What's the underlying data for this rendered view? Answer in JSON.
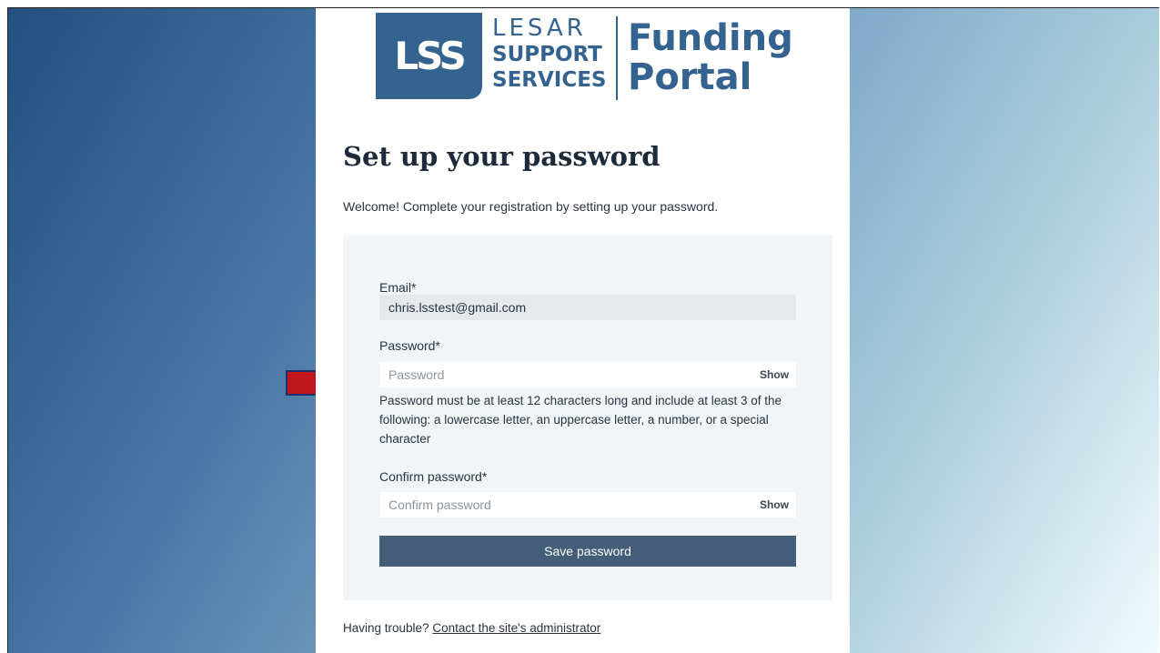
{
  "logo": {
    "mark": "LSS",
    "line1": "LESAR",
    "line2": "SUPPORT",
    "line3": "SERVICES",
    "product_line1": "Funding",
    "product_line2": "Portal",
    "brand_color": "#346390"
  },
  "page": {
    "title": "Set up your password",
    "intro": "Welcome! Complete your registration by setting up your password."
  },
  "form": {
    "email_label": "Email*",
    "email_value": "chris.lsstest@gmail.com",
    "password_label": "Password*",
    "password_placeholder": "Password",
    "password_show": "Show",
    "password_hint": "Password must be at least 12 characters long and include at least 3 of the following: a lowercase letter, an uppercase letter, a number, or a special character",
    "confirm_label": "Confirm password*",
    "confirm_placeholder": "Confirm password",
    "confirm_show": "Show",
    "save_button": "Save password",
    "button_color": "#445d78"
  },
  "footer": {
    "trouble_text": "Having trouble?",
    "contact_link": "Contact the site's administrator"
  },
  "annotation": {
    "arrow_color": "#c0151b",
    "arrow_icon": "right-arrow-icon"
  }
}
